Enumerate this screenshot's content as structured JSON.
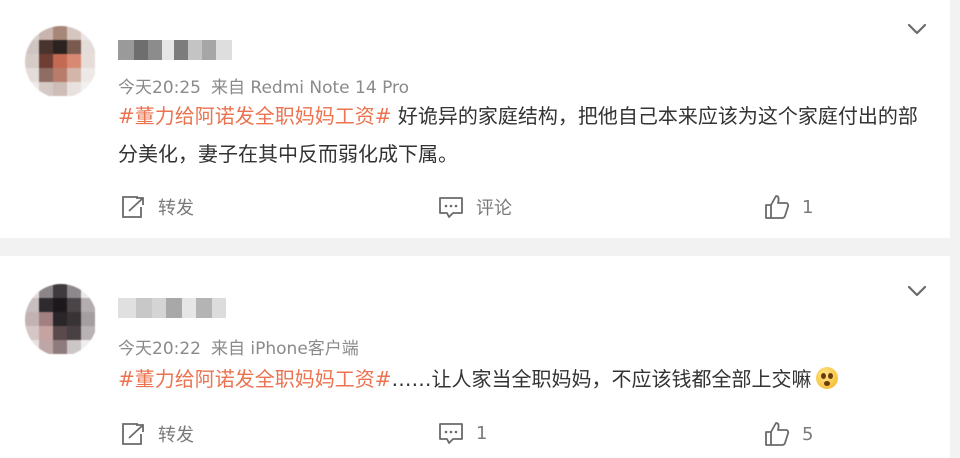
{
  "posts": [
    {
      "timestamp": "今天20:25",
      "source": "来自 Redmi Note 14 Pro",
      "topic": "#董力给阿诺发全职妈妈工资#",
      "text": " 好诡异的家庭结构，把他自己本来应该为这个家庭付出的部分美化，妻子在其中反而弱化成下属。",
      "actions": {
        "forward_label": "转发",
        "comment_label": "评论",
        "like_count": "1"
      }
    },
    {
      "timestamp": "今天20:22",
      "source": "来自 iPhone客户端",
      "topic": "#董力给阿诺发全职妈妈工资#",
      "text": "……让人家当全职妈妈，不应该钱都全部上交嘛",
      "emoji": "flushed-face-emoji",
      "actions": {
        "forward_label": "转发",
        "comment_count": "1",
        "like_count": "5"
      }
    }
  ],
  "colors": {
    "topic": "#eb7350",
    "meta": "#8a8a8a",
    "action": "#7a7a7a",
    "background": "#f2f2f2"
  },
  "icons": [
    "chevron-down-icon",
    "forward-icon",
    "comment-icon",
    "like-icon"
  ]
}
